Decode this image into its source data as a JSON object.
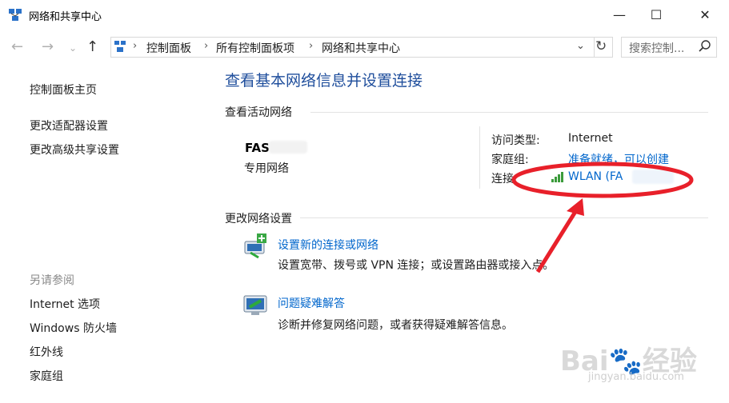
{
  "window": {
    "title": "网络和共享中心",
    "minimize": "—",
    "maximize": "☐",
    "close": "✕"
  },
  "address": {
    "crumbs": [
      "控制面板",
      "所有控制面板项",
      "网络和共享中心"
    ],
    "search_placeholder": "搜索控制..."
  },
  "sidebar": {
    "links": [
      "控制面板主页",
      "更改适配器设置",
      "更改高级共享设置"
    ],
    "see_also_heading": "另请参阅",
    "see_also": [
      "Internet 选项",
      "Windows 防火墙",
      "红外线",
      "家庭组"
    ]
  },
  "main": {
    "title": "查看基本网络信息并设置连接",
    "active_networks_label": "查看活动网络",
    "network": {
      "name": "FAS",
      "type": "专用网络",
      "access_type_label": "访问类型:",
      "access_type_value": "Internet",
      "homegroup_label": "家庭组:",
      "homegroup_value": "准备就绪，可以创建",
      "connection_label": "连接:",
      "connection_value": "WLAN (FA"
    },
    "change_settings_label": "更改网络设置",
    "settings": [
      {
        "link": "设置新的连接或网络",
        "desc": "设置宽带、拨号或 VPN 连接；或设置路由器或接入点。"
      },
      {
        "link": "问题疑难解答",
        "desc": "诊断并修复网络问题，或者获得疑难解答信息。"
      }
    ]
  },
  "watermark": {
    "brand": "Bai",
    "brand2": "经验",
    "url": "jingyan.baidu.com"
  },
  "colors": {
    "link": "#0066cc",
    "title": "#1f4e9c",
    "annotation": "#e8202a"
  }
}
